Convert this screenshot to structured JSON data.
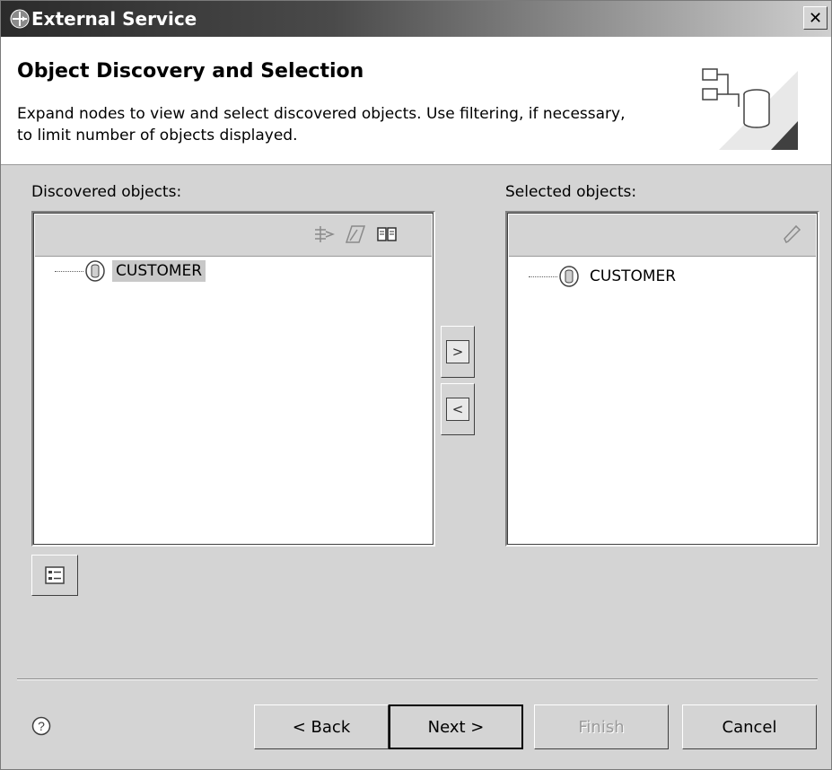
{
  "window": {
    "title": "External Service",
    "close_icon": "close-icon",
    "app_icon": "external-service-icon"
  },
  "header": {
    "title": "Object Discovery and Selection",
    "description": "Expand nodes to view and select discovered objects.  Use filtering, if necessary, to limit number of objects displayed.",
    "graphic_icon": "database-discovery-graphic"
  },
  "discovered": {
    "label": "Discovered objects:",
    "toolbar_icons": [
      "filter-icon",
      "edit-query-icon",
      "open-book-icon"
    ],
    "items": [
      {
        "label": "CUSTOMER",
        "icon": "database-object-icon",
        "selected": true
      }
    ]
  },
  "selected": {
    "label": "Selected objects:",
    "toolbar_icons": [
      "pencil-icon"
    ],
    "items": [
      {
        "label": "CUSTOMER",
        "icon": "database-object-icon",
        "selected": false
      }
    ]
  },
  "transfer": {
    "add_label": ">",
    "remove_label": "<"
  },
  "properties_button_icon": "properties-list-icon",
  "footer": {
    "help_icon": "help-icon",
    "back_label": "< Back",
    "next_label": "Next >",
    "finish_label": "Finish",
    "cancel_label": "Cancel"
  }
}
